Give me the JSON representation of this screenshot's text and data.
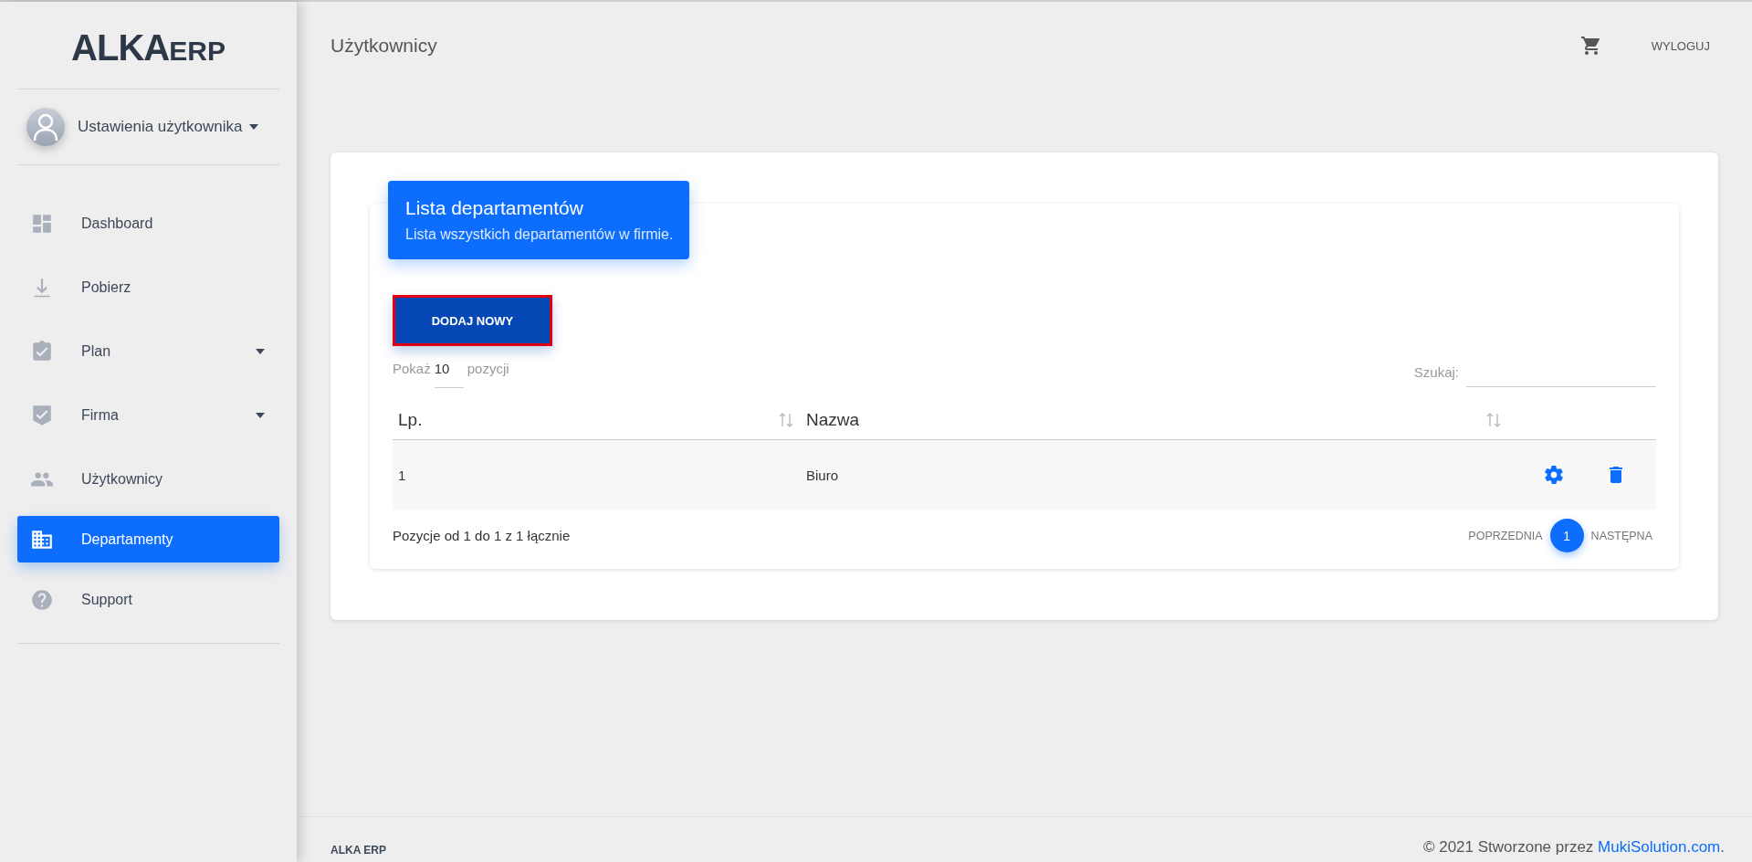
{
  "sidebar": {
    "logo": {
      "main": "ALKA",
      "suffix": "ERP"
    },
    "user": {
      "label": "Ustawienia użytkownika"
    },
    "items": [
      {
        "label": "Dashboard",
        "dropdown": false,
        "selected": false
      },
      {
        "label": "Pobierz",
        "dropdown": false,
        "selected": false
      },
      {
        "label": "Plan",
        "dropdown": true,
        "selected": false
      },
      {
        "label": "Firma",
        "dropdown": true,
        "selected": false
      },
      {
        "label": "Użytkownicy",
        "dropdown": false,
        "selected": false
      },
      {
        "label": "Departamenty",
        "dropdown": false,
        "selected": true
      },
      {
        "label": "Support",
        "dropdown": false,
        "selected": false
      }
    ]
  },
  "topbar": {
    "title": "Użytkownicy",
    "logout": "WYLOGUJ"
  },
  "card": {
    "title": "Lista departamentów",
    "subtitle": "Lista wszystkich departamentów w firmie.",
    "add_button": "DODAJ NOWY",
    "show": {
      "before": "Pokaż",
      "value": "10",
      "after": "pozycji"
    },
    "search": {
      "label": "Szukaj:"
    },
    "table": {
      "columns": [
        "Lp.",
        "Nazwa"
      ],
      "rows": [
        {
          "cells": [
            "1",
            "Biuro"
          ]
        }
      ]
    },
    "info": "Pozycje od 1 do 1 z 1 łącznie",
    "pagination": {
      "prev": "POPRZEDNIA",
      "pages": [
        {
          "label": "1",
          "selected": true
        }
      ],
      "next": "NASTĘPNA"
    }
  },
  "footer": {
    "left": "ALKA ERP",
    "copyright": "© 2021 Stworzone przez ",
    "link": "MukiSolution.com",
    "end": "."
  }
}
